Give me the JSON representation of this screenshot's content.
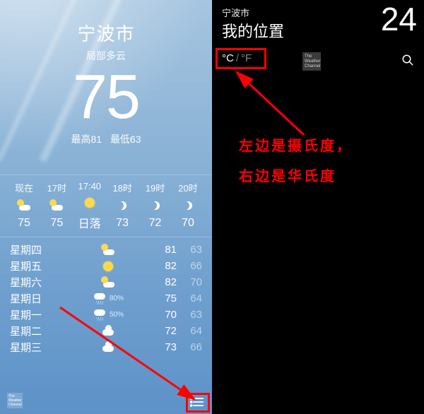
{
  "left": {
    "city": "宁波市",
    "condition": "局部多云",
    "temp": "75",
    "hi_label": "最高81",
    "lo_label": "最低63",
    "hourly": [
      {
        "time": "现在",
        "icon": "partly-cloudy",
        "value": "75"
      },
      {
        "time": "17时",
        "icon": "partly-cloudy",
        "value": "75"
      },
      {
        "time": "17:40",
        "icon": "sun",
        "value": "日落"
      },
      {
        "time": "18时",
        "icon": "moon",
        "value": "73"
      },
      {
        "time": "19时",
        "icon": "moon",
        "value": "72"
      },
      {
        "time": "20时",
        "icon": "moon",
        "value": "70"
      }
    ],
    "daily": [
      {
        "day": "星期四",
        "icon": "partly-cloudy",
        "pct": "",
        "hi": "81",
        "lo": "63"
      },
      {
        "day": "星期五",
        "icon": "sun",
        "pct": "",
        "hi": "82",
        "lo": "66"
      },
      {
        "day": "星期六",
        "icon": "partly-cloudy",
        "pct": "",
        "hi": "82",
        "lo": "70"
      },
      {
        "day": "星期日",
        "icon": "rain",
        "pct": "80%",
        "hi": "75",
        "lo": "64"
      },
      {
        "day": "星期一",
        "icon": "rain",
        "pct": "50%",
        "hi": "70",
        "lo": "63"
      },
      {
        "day": "星期二",
        "icon": "cloud",
        "pct": "",
        "hi": "72",
        "lo": "64"
      },
      {
        "day": "星期三",
        "icon": "cloud",
        "pct": "",
        "hi": "73",
        "lo": "66"
      }
    ],
    "twc": "The Weather Channel"
  },
  "right": {
    "city": "宁波市",
    "location_label": "我的位置",
    "temp": "24",
    "unit_c": "°C",
    "unit_f": "°F",
    "twc": "The Weather Channel",
    "annotation_line1": "左边是摄氏度，",
    "annotation_line2": "右边是华氏度"
  }
}
